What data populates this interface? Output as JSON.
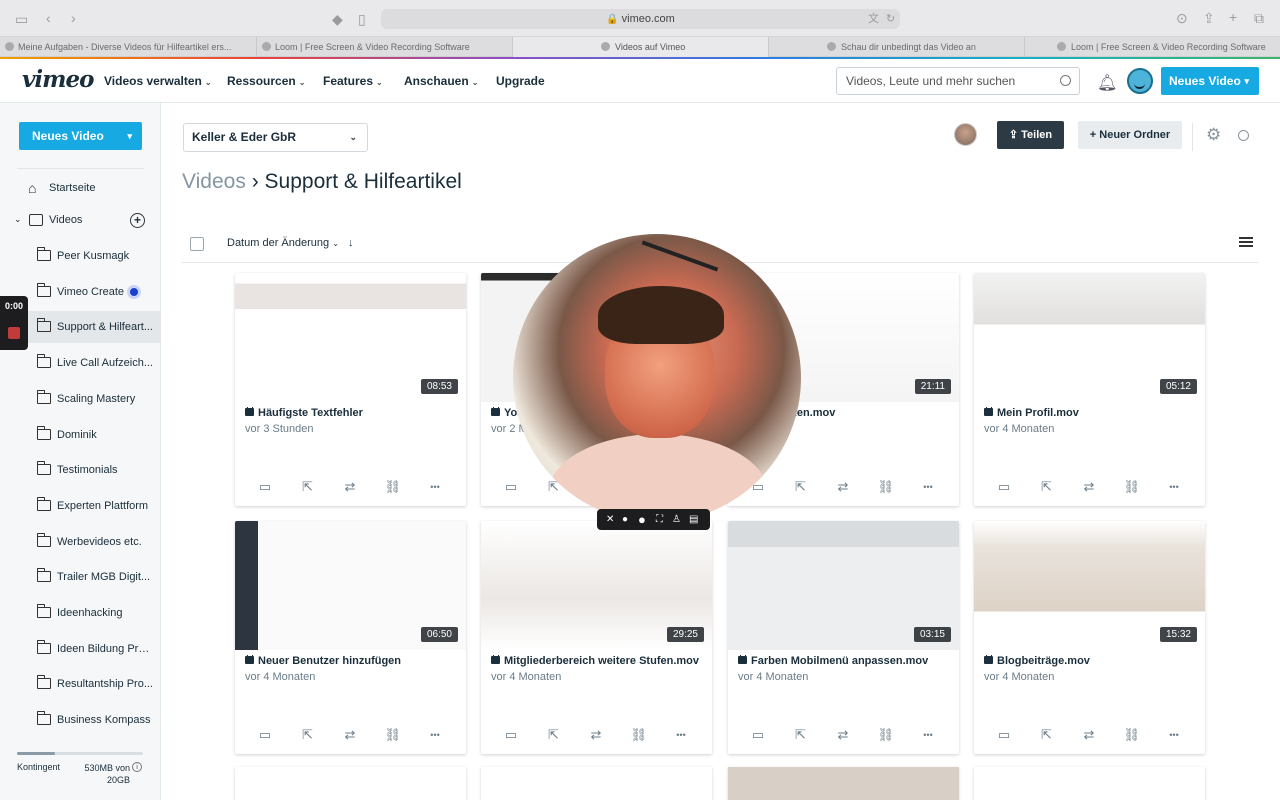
{
  "browser": {
    "url": "vimeo.com",
    "tabs": [
      {
        "title": "Meine Aufgaben - Diverse Videos für Hilfeartikel ers..."
      },
      {
        "title": "Loom | Free Screen & Video Recording Software"
      },
      {
        "title": "Videos auf Vimeo"
      },
      {
        "title": "Schau dir unbedingt das Video an"
      },
      {
        "title": "Loom | Free Screen & Video Recording Software"
      }
    ]
  },
  "topnav": {
    "logo": "vimeo",
    "items": [
      "Videos verwalten",
      "Ressourcen",
      "Features",
      "Anschauen",
      "Upgrade"
    ],
    "search_placeholder": "Videos, Leute und mehr suchen",
    "new_video": "Neues Video"
  },
  "sidebar": {
    "new_video": "Neues Video",
    "home": "Startseite",
    "videos": "Videos",
    "folders": [
      "Peer Kusmagk",
      "Vimeo Create",
      "Support & Hilfeart...",
      "Live Call Aufzeich...",
      "Scaling Mastery",
      "Dominik",
      "Testimonials",
      "Experten Plattform",
      "Werbevideos etc.",
      "Trailer MGB Digit...",
      "Ideenhacking",
      "Ideen Bildung Pro...",
      "Resultantship Pro...",
      "Business Kompass"
    ],
    "quota_label": "Kontingent",
    "quota_value": "530MB von 20GB",
    "quota_used_fraction": 0.026
  },
  "recording": {
    "timer": "0:00"
  },
  "main": {
    "team": "Keller & Eder GbR",
    "share": "Teilen",
    "new_folder": "Neuer Ordner",
    "breadcrumb_root": "Videos",
    "breadcrumb_sep": "›",
    "breadcrumb_current": "Support & Hilfeartikel",
    "sort_label": "Datum der Änderung",
    "videos": [
      {
        "title": "Häufigste Textfehler",
        "meta": "vor 3 Stunden",
        "duration": "08:53"
      },
      {
        "title": "Yoa...",
        "meta": "vor 2 M...",
        "duration": ""
      },
      {
        "title": "...Ergänzen.mov",
        "meta": "...naten",
        "duration": "21:11"
      },
      {
        "title": "Mein Profil.mov",
        "meta": "vor 4 Monaten",
        "duration": "05:12"
      },
      {
        "title": "Neuer Benutzer hinzufügen",
        "meta": "vor 4 Monaten",
        "duration": "06:50"
      },
      {
        "title": "Mitgliederbereich weitere Stufen.mov",
        "meta": "vor 4 Monaten",
        "duration": "29:25"
      },
      {
        "title": "Farben Mobilmenü anpassen.mov",
        "meta": "vor 4 Monaten",
        "duration": "03:15"
      },
      {
        "title": "Blogbeiträge.mov",
        "meta": "vor 4 Monaten",
        "duration": "15:32"
      }
    ]
  }
}
